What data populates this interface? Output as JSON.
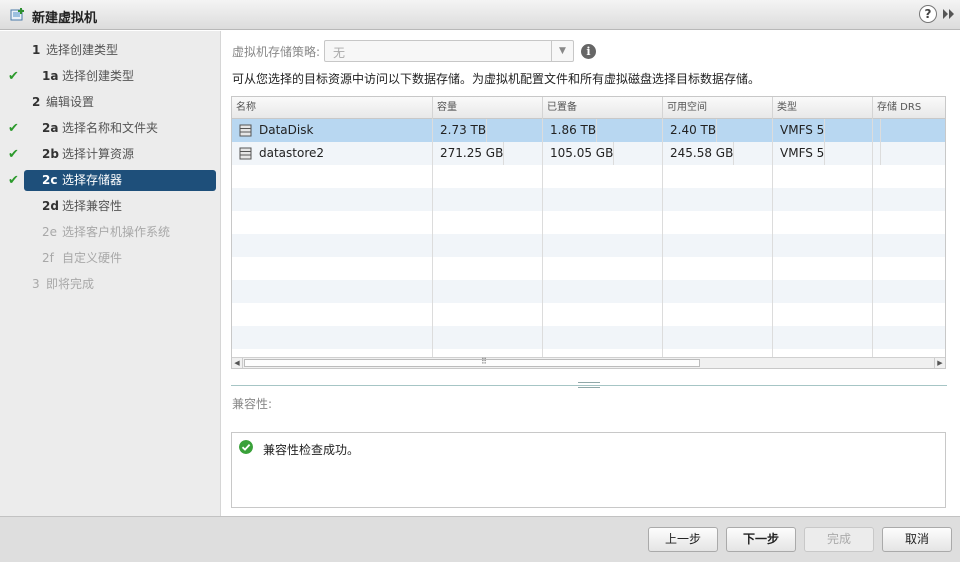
{
  "window": {
    "title": "新建虚拟机",
    "help": "?"
  },
  "steps": [
    {
      "num": "1",
      "label": "选择创建类型",
      "checked": false,
      "disabled": false
    },
    {
      "num": "1a",
      "label": "选择创建类型",
      "checked": true,
      "disabled": false
    },
    {
      "num": "2",
      "label": "编辑设置",
      "checked": false,
      "disabled": false
    },
    {
      "num": "2a",
      "label": "选择名称和文件夹",
      "checked": true,
      "disabled": false
    },
    {
      "num": "2b",
      "label": "选择计算资源",
      "checked": true,
      "disabled": false
    },
    {
      "num": "2c",
      "label": "选择存储器",
      "checked": true,
      "disabled": false,
      "active": true
    },
    {
      "num": "2d",
      "label": "选择兼容性",
      "checked": false,
      "disabled": false
    },
    {
      "num": "2e",
      "label": "选择客户机操作系统",
      "checked": false,
      "disabled": true
    },
    {
      "num": "2f",
      "label": "自定义硬件",
      "checked": false,
      "disabled": true
    },
    {
      "num": "3",
      "label": "即将完成",
      "checked": false,
      "disabled": true
    }
  ],
  "policy": {
    "label": "虚拟机存储策略:",
    "value": "无"
  },
  "description": "可从您选择的目标资源中访问以下数据存储。为虚拟机配置文件和所有虚拟磁盘选择目标数据存储。",
  "table": {
    "columns": [
      "名称",
      "容量",
      "已置备",
      "可用空间",
      "类型",
      "存储 DRS"
    ],
    "rows": [
      {
        "name": "DataDisk",
        "capacity": "2.73 TB",
        "provisioned": "1.86 TB",
        "free": "2.40 TB",
        "type": "VMFS 5",
        "drs": "",
        "selected": true
      },
      {
        "name": "datastore2",
        "capacity": "271.25 GB",
        "provisioned": "105.05 GB",
        "free": "245.58 GB",
        "type": "VMFS 5",
        "drs": "",
        "selected": false
      }
    ]
  },
  "compatibility": {
    "label": "兼容性:",
    "message": "兼容性检查成功。"
  },
  "buttons": {
    "back": "上一步",
    "next": "下一步",
    "finish": "完成",
    "cancel": "取消"
  }
}
